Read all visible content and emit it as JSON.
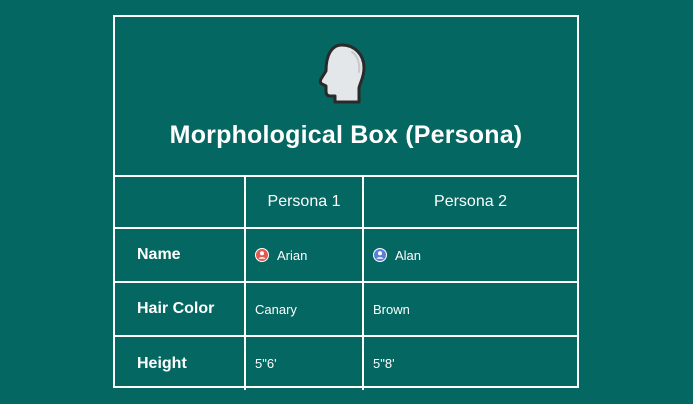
{
  "title": "Morphological Box (Persona)",
  "icons": {
    "header": "human-head-icon",
    "persona1_avatar": "user-avatar-red-icon",
    "persona2_avatar": "user-avatar-blue-icon"
  },
  "colors": {
    "background": "#046762",
    "border": "#ffffff",
    "avatar1": "#e05a4f",
    "avatar2": "#5b7fd6"
  },
  "columns": [
    "",
    "Persona 1",
    "Persona 2"
  ],
  "rows": {
    "name": {
      "label": "Name",
      "p1": "Arian",
      "p2": "Alan"
    },
    "hair": {
      "label": "Hair Color",
      "p1": "Canary",
      "p2": "Brown"
    },
    "height": {
      "label": "Height",
      "p1": "5\"6'",
      "p2": "5\"8'"
    }
  }
}
